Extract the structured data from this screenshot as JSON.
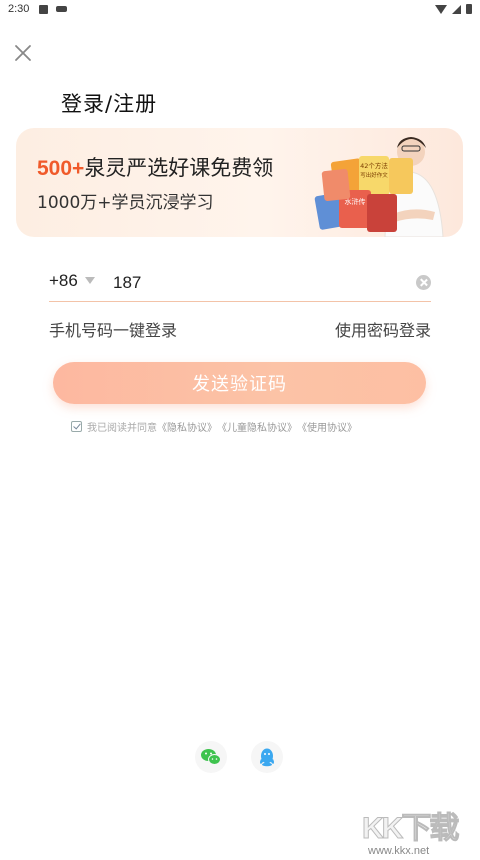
{
  "status_bar": {
    "time": "2:30"
  },
  "page": {
    "title": "登录/注册"
  },
  "banner": {
    "headline_accent": "500+",
    "headline_rest": "泉灵严选好课免费领",
    "subtitle": "1000万+学员沉浸学习",
    "book_labels": [
      "42个方法",
      "写出好作文",
      "水浒传"
    ]
  },
  "phone": {
    "country_code": "+86",
    "value": "187"
  },
  "links": {
    "one_click_login": "手机号码一键登录",
    "password_login": "使用密码登录"
  },
  "send_button": {
    "label": "发送验证码"
  },
  "agreement": {
    "prefix": "我已阅读并同意",
    "privacy": "《隐私协议》",
    "child_privacy": "《儿童隐私协议》",
    "usage": "《使用协议》"
  },
  "social": [
    {
      "icon": "wechat-icon",
      "color": "#3ec34e"
    },
    {
      "icon": "qq-icon",
      "color": "#3ba8f0"
    }
  ],
  "watermark": {
    "logo": "KK下载",
    "url": "www.kkx.net"
  },
  "colors": {
    "accent": "#f05a2a",
    "button": "#fcbfa4",
    "underline": "#f3c3a8"
  }
}
